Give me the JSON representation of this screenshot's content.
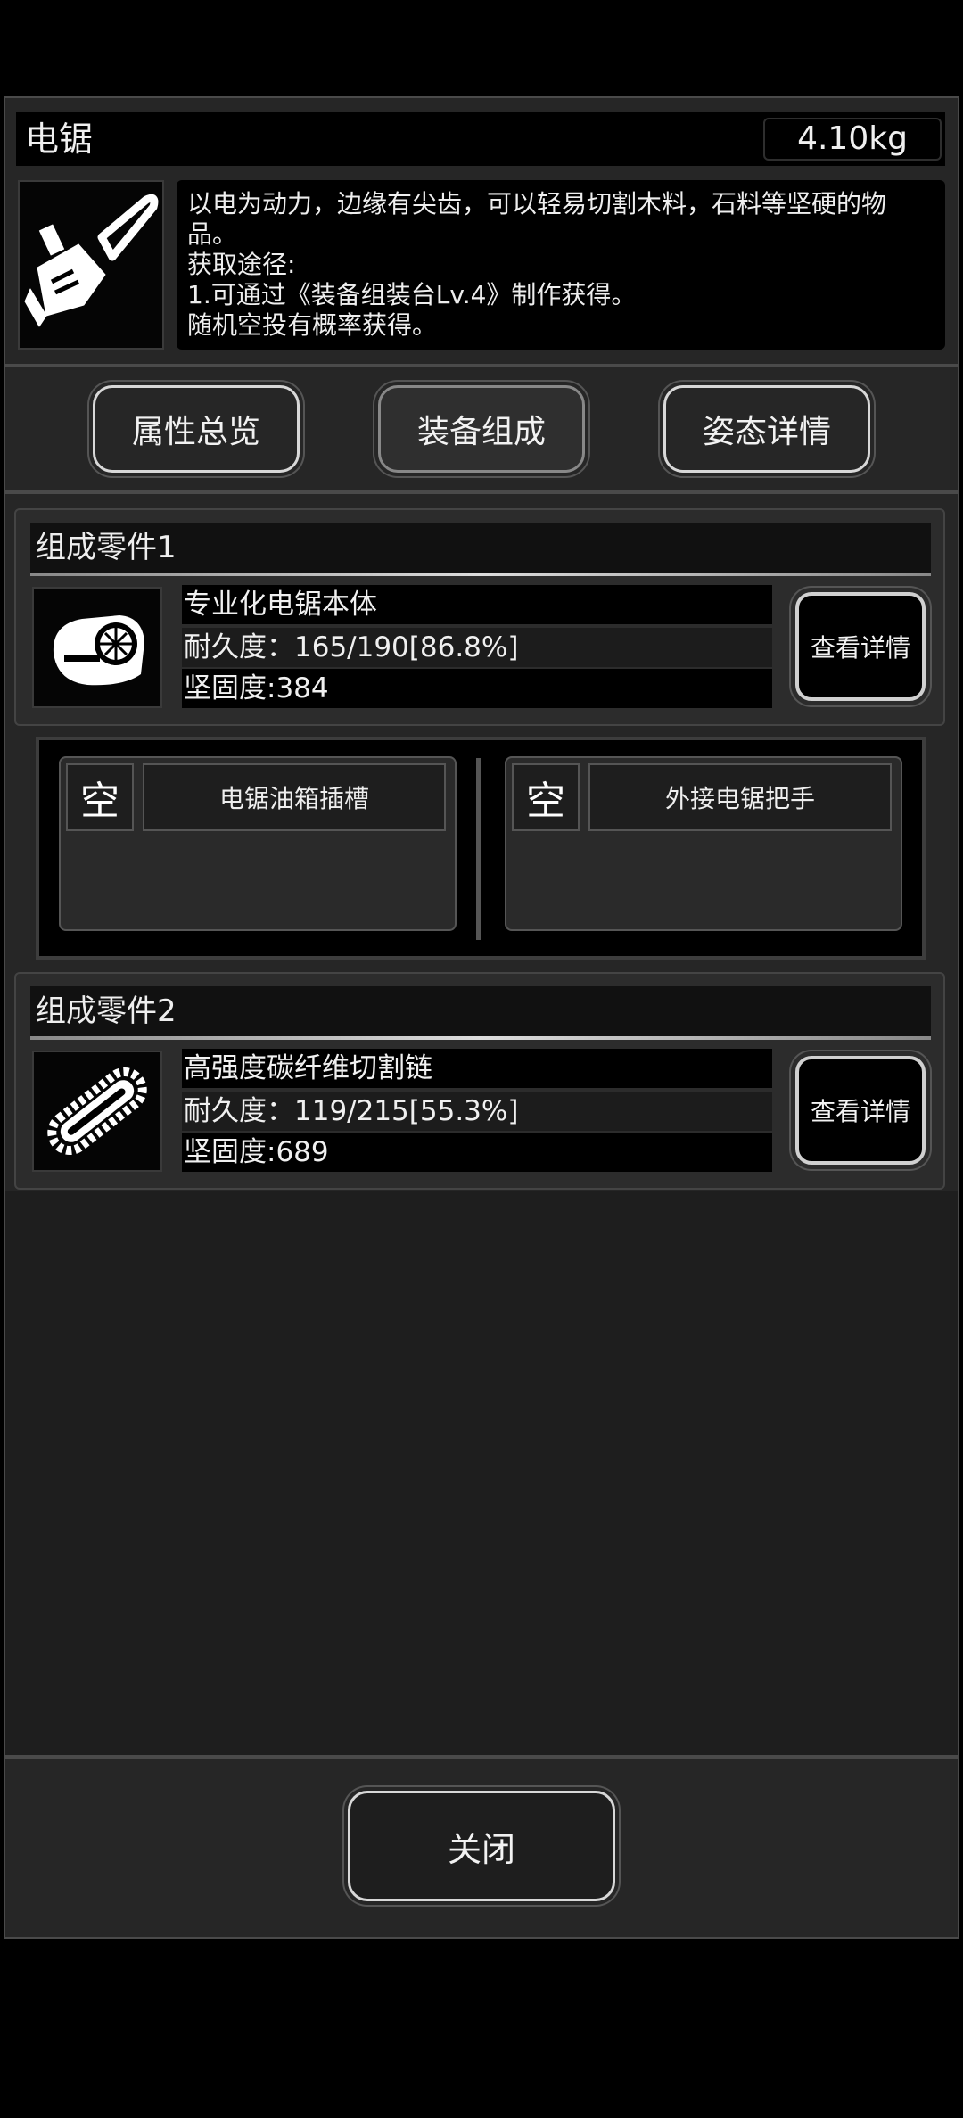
{
  "item": {
    "name": "电锯",
    "weight": "4.10kg",
    "description_lines": [
      "以电为动力，边缘有尖齿，可以轻易切割木料，石料等坚硬的物",
      "品。",
      "获取途径:",
      "1.可通过《装备组装台Lv.4》制作获得。",
      "随机空投有概率获得。"
    ]
  },
  "tabs": [
    "属性总览",
    "装备组成",
    "姿态详情"
  ],
  "active_tab": "装备组成",
  "parts": [
    {
      "title": "组成零件1",
      "name": "专业化电锯本体",
      "durability": "耐久度：165/190[86.8%]",
      "hardness": "坚固度:384",
      "detail_label": "查看详情",
      "slots": [
        {
          "state": "空",
          "name": "电锯油箱插槽"
        },
        {
          "state": "空",
          "name": "外接电锯把手"
        }
      ]
    },
    {
      "title": "组成零件2",
      "name": "高强度碳纤维切割链",
      "durability": "耐久度：119/215[55.3%]",
      "hardness": "坚固度:689",
      "detail_label": "查看详情"
    }
  ],
  "close_label": "关闭",
  "colors": {
    "background": "#000000",
    "panel": "#262626",
    "text": "#eeeeee"
  },
  "icons": [
    "chainsaw-icon",
    "saw-engine-icon",
    "saw-chain-icon"
  ]
}
